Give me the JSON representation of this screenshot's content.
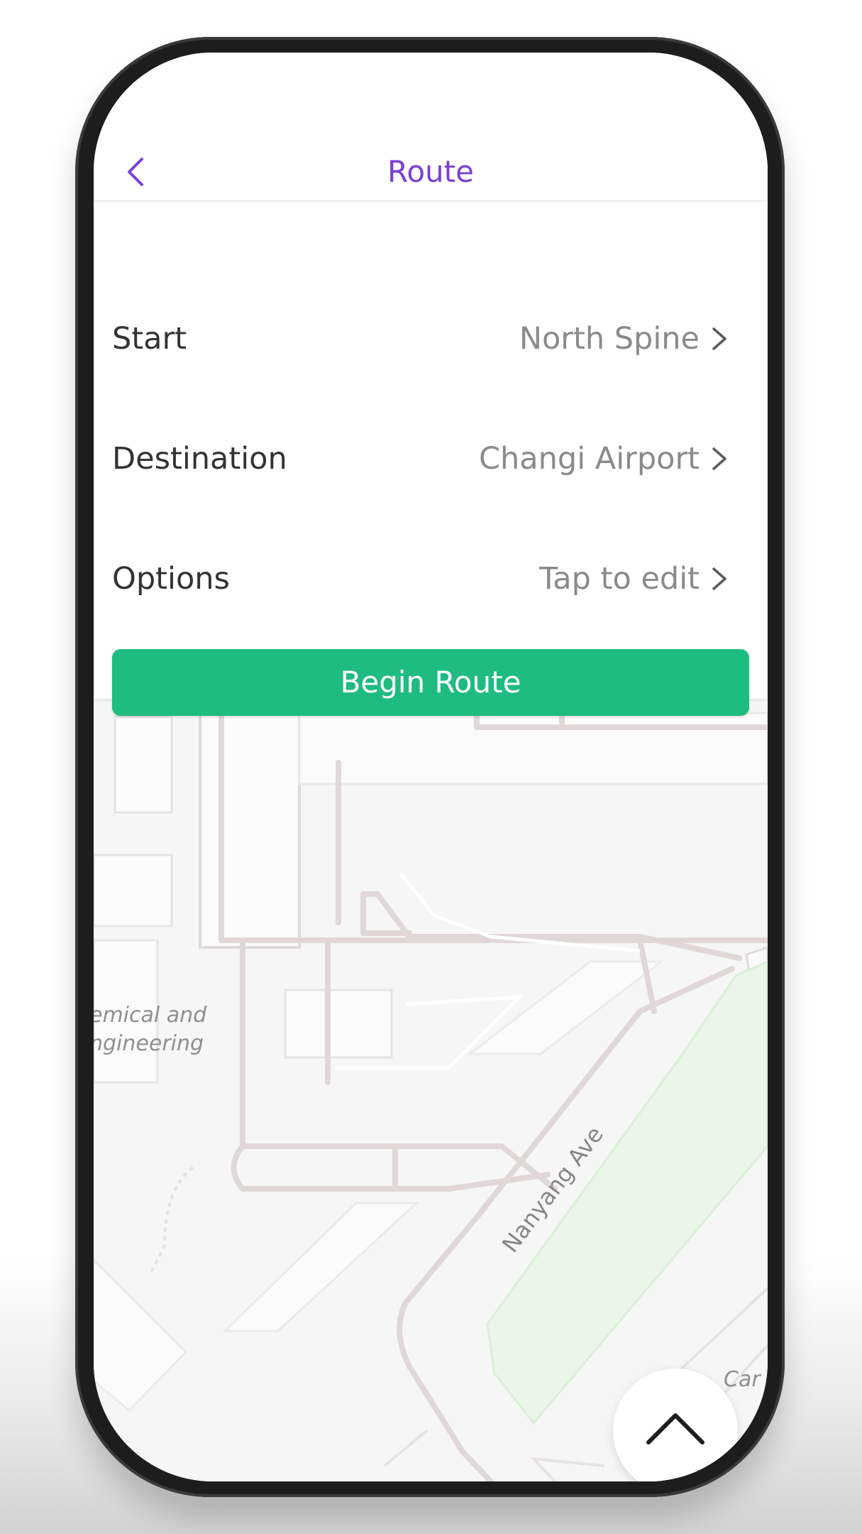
{
  "navbar": {
    "title": "Route",
    "back_icon": "chevron-left-icon"
  },
  "form": {
    "rows": [
      {
        "label": "Start",
        "value": "North Spine"
      },
      {
        "label": "Destination",
        "value": "Changi Airport"
      },
      {
        "label": "Options",
        "value": "Tap to edit"
      }
    ],
    "begin_label": "Begin Route"
  },
  "map": {
    "labels": [
      "emical and",
      "ngineering",
      "Nanyang Ave",
      "Car P"
    ]
  },
  "fab": {
    "icon": "chevron-up-icon"
  },
  "colors": {
    "accent": "#7b3fd6",
    "primary_button": "#1fbc81",
    "park": "#e9f6e8"
  }
}
